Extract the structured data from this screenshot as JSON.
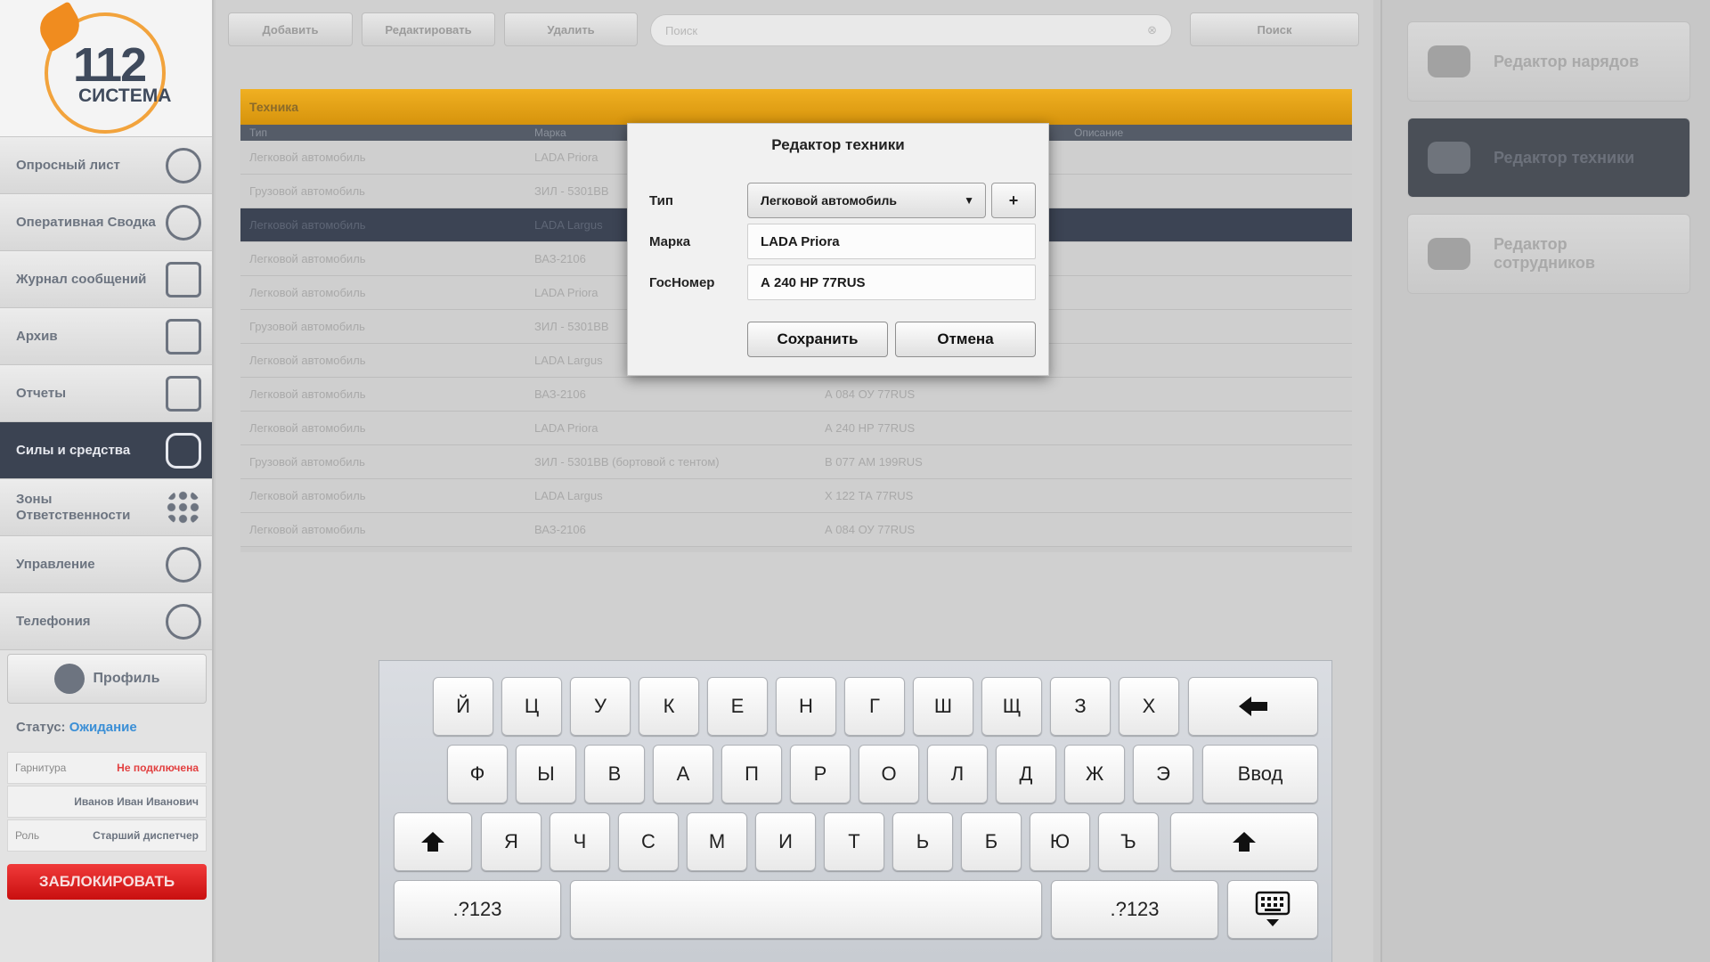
{
  "sidebar": {
    "logo": {
      "number": "112",
      "word": "СИСТЕМА"
    },
    "items": [
      {
        "label": "Опросный лист",
        "icon": "speech-bubble-icon"
      },
      {
        "label": "Оперативная Сводка",
        "icon": "headset-icon"
      },
      {
        "label": "Журнал сообщений",
        "icon": "envelope-icon"
      },
      {
        "label": "Архив",
        "icon": "cabinet-icon"
      },
      {
        "label": "Отчеты",
        "icon": "calculator-icon"
      },
      {
        "label": "Силы и средства",
        "icon": "car-icon",
        "active": true
      },
      {
        "label": "Зоны Ответственности",
        "icon": "grid-icon"
      },
      {
        "label": "Управление",
        "icon": "gears-icon"
      },
      {
        "label": "Телефония",
        "icon": "phone-icon"
      }
    ],
    "profile_label": "Профиль",
    "status_label": "Статус:",
    "status_value": "Ожидание",
    "headset_label": "Гарнитура",
    "headset_value": "Не подключена",
    "user_name": "Иванов Иван Иванович",
    "role_label": "Роль",
    "role_value": "Старший диспетчер",
    "lock_label": "ЗАБЛОКИРОВАТЬ"
  },
  "toolbar": {
    "add_label": "Добавить",
    "edit_label": "Редактировать",
    "delete_label": "Удалить",
    "search_placeholder": "Поиск",
    "search_label": "Поиск"
  },
  "grid": {
    "title": "Техника",
    "columns": [
      "Тип",
      "Марка",
      "",
      "Описание"
    ],
    "rows": [
      {
        "type": "Легковой автомобиль",
        "brand": "LADA Priora",
        "plate": ""
      },
      {
        "type": "Грузовой автомобиль",
        "brand": "ЗИЛ - 5301ВВ",
        "plate": ""
      },
      {
        "type": "Легковой автомобиль",
        "brand": "LADA Largus",
        "plate": ""
      },
      {
        "type": "Легковой автомобиль",
        "brand": "ВАЗ-2106",
        "plate": ""
      },
      {
        "type": "Легковой автомобиль",
        "brand": "LADA Priora",
        "plate": ""
      },
      {
        "type": "Грузовой автомобиль",
        "brand": "ЗИЛ - 5301ВВ",
        "plate": ""
      },
      {
        "type": "Легковой автомобиль",
        "brand": "LADA Largus",
        "plate": ""
      },
      {
        "type": "Легковой автомобиль",
        "brand": "ВАЗ-2106",
        "plate": "А 084 ОУ 77RUS"
      },
      {
        "type": "Легковой автомобиль",
        "brand": "LADA Priora",
        "plate": "А 240 НР 77RUS"
      },
      {
        "type": "Грузовой автомобиль",
        "brand": "ЗИЛ - 5301ВВ (бортовой с тентом)",
        "plate": "В 077 АМ 199RUS"
      },
      {
        "type": "Легковой автомобиль",
        "brand": "LADA Largus",
        "plate": "Х 122 ТА 77RUS"
      },
      {
        "type": "Легковой автомобиль",
        "brand": "ВАЗ-2106",
        "plate": "А 084 ОУ 77RUS"
      }
    ]
  },
  "right_panel": {
    "buttons": [
      {
        "label": "Редактор нарядов",
        "icon": "car-front-icon"
      },
      {
        "label": "Редактор техники",
        "icon": "car-side-icon",
        "active": true
      },
      {
        "label": "Редактор сотрудников",
        "icon": "people-icon"
      }
    ]
  },
  "dialog": {
    "title": "Редактор техники",
    "type_label": "Тип",
    "type_value": "Легковой автомобиль",
    "add_type_label": "+",
    "brand_label": "Марка",
    "brand_value": "LADA Priora",
    "plate_label": "ГосНомер",
    "plate_value": "А 240 НР 77RUS",
    "save_label": "Сохранить",
    "cancel_label": "Отмена"
  },
  "keyboard": {
    "row1": [
      "Й",
      "Ц",
      "У",
      "К",
      "Е",
      "Н",
      "Г",
      "Ш",
      "Щ",
      "З",
      "Х"
    ],
    "row2": [
      "Ф",
      "Ы",
      "В",
      "А",
      "П",
      "Р",
      "О",
      "Л",
      "Д",
      "Ж",
      "Э"
    ],
    "enter_label": "Ввод",
    "row3": [
      "Я",
      "Ч",
      "С",
      "М",
      "И",
      "Т",
      "Ь",
      "Б",
      "Ю",
      "Ъ"
    ],
    "numbers_label": ".?123"
  }
}
